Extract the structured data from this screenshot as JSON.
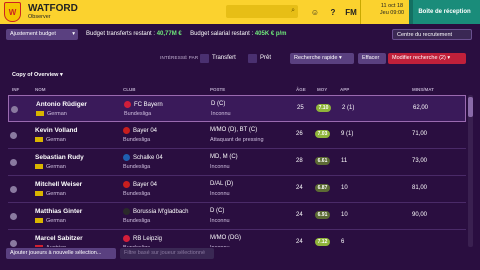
{
  "topbar": {
    "club": "WATFORD",
    "subtitle": "Observer",
    "search_placeholder": "",
    "fm_label": "FM",
    "date_line1": "11 oct 18",
    "date_line2": "Jeu 09:00",
    "inbox": "Boîte de réception",
    "crest_text": "W",
    "help": "?"
  },
  "budget": {
    "dropdown": "Ajustement budget",
    "transfer_label": "Budget transferts restant :",
    "transfer_value": "40,77M €",
    "salary_label": "Budget salarial restant :",
    "salary_value": "405K € p/m",
    "recruit_btn": "Centre du recrutement"
  },
  "filters": {
    "interested": "INTÉRESSÉ PAR :",
    "transfer": "Transfert",
    "loan": "Prêt",
    "quick_search": "Recherche rapide",
    "clear": "Effacer",
    "modify": "Modifier recherche (2)"
  },
  "view": {
    "title": "Copy of Overview"
  },
  "columns": {
    "inf": "INF",
    "name": "NOM",
    "club": "CLUB",
    "position": "POSTE",
    "age": "ÂGE",
    "avg": "MOY",
    "app": "APP",
    "minutes": "MINS/MAT"
  },
  "players": [
    {
      "name": "Antonio Rüdiger",
      "nationality": "German",
      "club": "FC Bayern",
      "league": "Bundesliga",
      "position": "D (C)",
      "role": "Inconnu",
      "age": "25",
      "avg": "7.10",
      "app": "2 (1)",
      "minutes": "62,00",
      "avg_color": "#8fb43a",
      "club_color": "#d01e3a",
      "flag": "#d9b500"
    },
    {
      "name": "Kevin Volland",
      "nationality": "German",
      "club": "Bayer 04",
      "league": "Bundesliga",
      "position": "M/MO (D), BT (C)",
      "role": "Attaquant de pressing",
      "age": "26",
      "avg": "7.03",
      "app": "9 (1)",
      "minutes": "71,00",
      "avg_color": "#8fb43a",
      "club_color": "#c81e1e",
      "flag": "#d9b500"
    },
    {
      "name": "Sebastian Rudy",
      "nationality": "German",
      "club": "Schalke 04",
      "league": "Bundesliga",
      "position": "MD, M (C)",
      "role": "Inconnu",
      "age": "28",
      "avg": "6.61",
      "app": "11",
      "minutes": "73,00",
      "avg_color": "#5c6a34",
      "club_color": "#1f5fb0",
      "flag": "#d9b500"
    },
    {
      "name": "Mitchell Weiser",
      "nationality": "German",
      "club": "Bayer 04",
      "league": "Bundesliga",
      "position": "D/AL (D)",
      "role": "Inconnu",
      "age": "24",
      "avg": "6.87",
      "app": "10",
      "minutes": "81,00",
      "avg_color": "#5c6a34",
      "club_color": "#c81e1e",
      "flag": "#d9b500"
    },
    {
      "name": "Matthias Ginter",
      "nationality": "German",
      "club": "Borussia M'gladbach",
      "league": "Bundesliga",
      "position": "D (C)",
      "role": "Inconnu",
      "age": "24",
      "avg": "6.91",
      "app": "10",
      "minutes": "90,00",
      "avg_color": "#5c6a34",
      "club_color": "#2a2a2a",
      "flag": "#d9b500"
    },
    {
      "name": "Marcel Sabitzer",
      "nationality": "Austrian",
      "club": "RB Leipzig",
      "league": "Bundesliga",
      "position": "M/MO (DG)",
      "role": "Inconnu",
      "age": "24",
      "avg": "7.12",
      "app": "6",
      "minutes": "",
      "avg_color": "#8fb43a",
      "club_color": "#d41e3a",
      "flag": "#d02030"
    }
  ],
  "footer": {
    "add_btn": "Ajouter joueurs à nouvelle sélection...",
    "filter_btn": "Filtre basé sur joueur sélectionné"
  }
}
